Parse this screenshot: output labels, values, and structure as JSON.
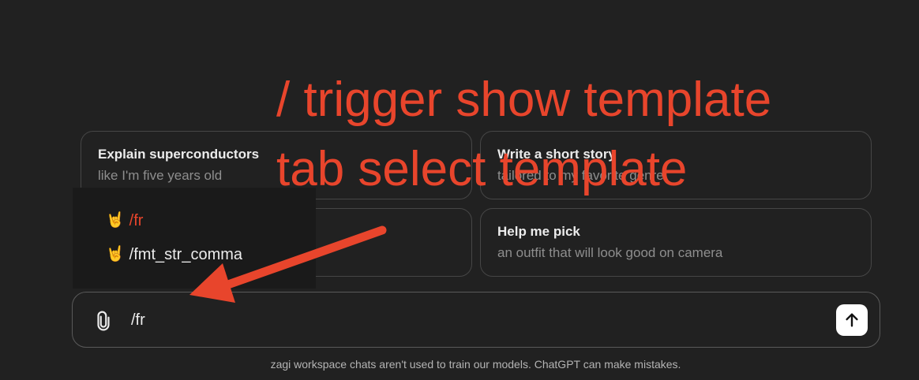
{
  "suggestions": [
    {
      "title": "Explain superconductors",
      "subtitle": "like I'm five years old"
    },
    {
      "title": "Write a short story",
      "subtitle": "tailored to my favorite genre"
    },
    {
      "title": "Help me pick",
      "subtitle": "an outfit that will look good on camera"
    }
  ],
  "popup": {
    "items": [
      {
        "emoji": "🤘",
        "label": "/fr",
        "color": "#e8452c"
      },
      {
        "emoji": "🤘",
        "label": "/fmt_str_comma",
        "color": "#ececec"
      }
    ]
  },
  "composer": {
    "value": "/fr",
    "attach_icon": "paperclip-icon",
    "send_icon": "arrow-up-icon"
  },
  "footer": {
    "text": "zagi workspace chats aren't used to train our models. ChatGPT can make mistakes."
  },
  "annotations": {
    "line1": "/ trigger show template",
    "line2": "tab select template",
    "color": "#e8452c"
  }
}
